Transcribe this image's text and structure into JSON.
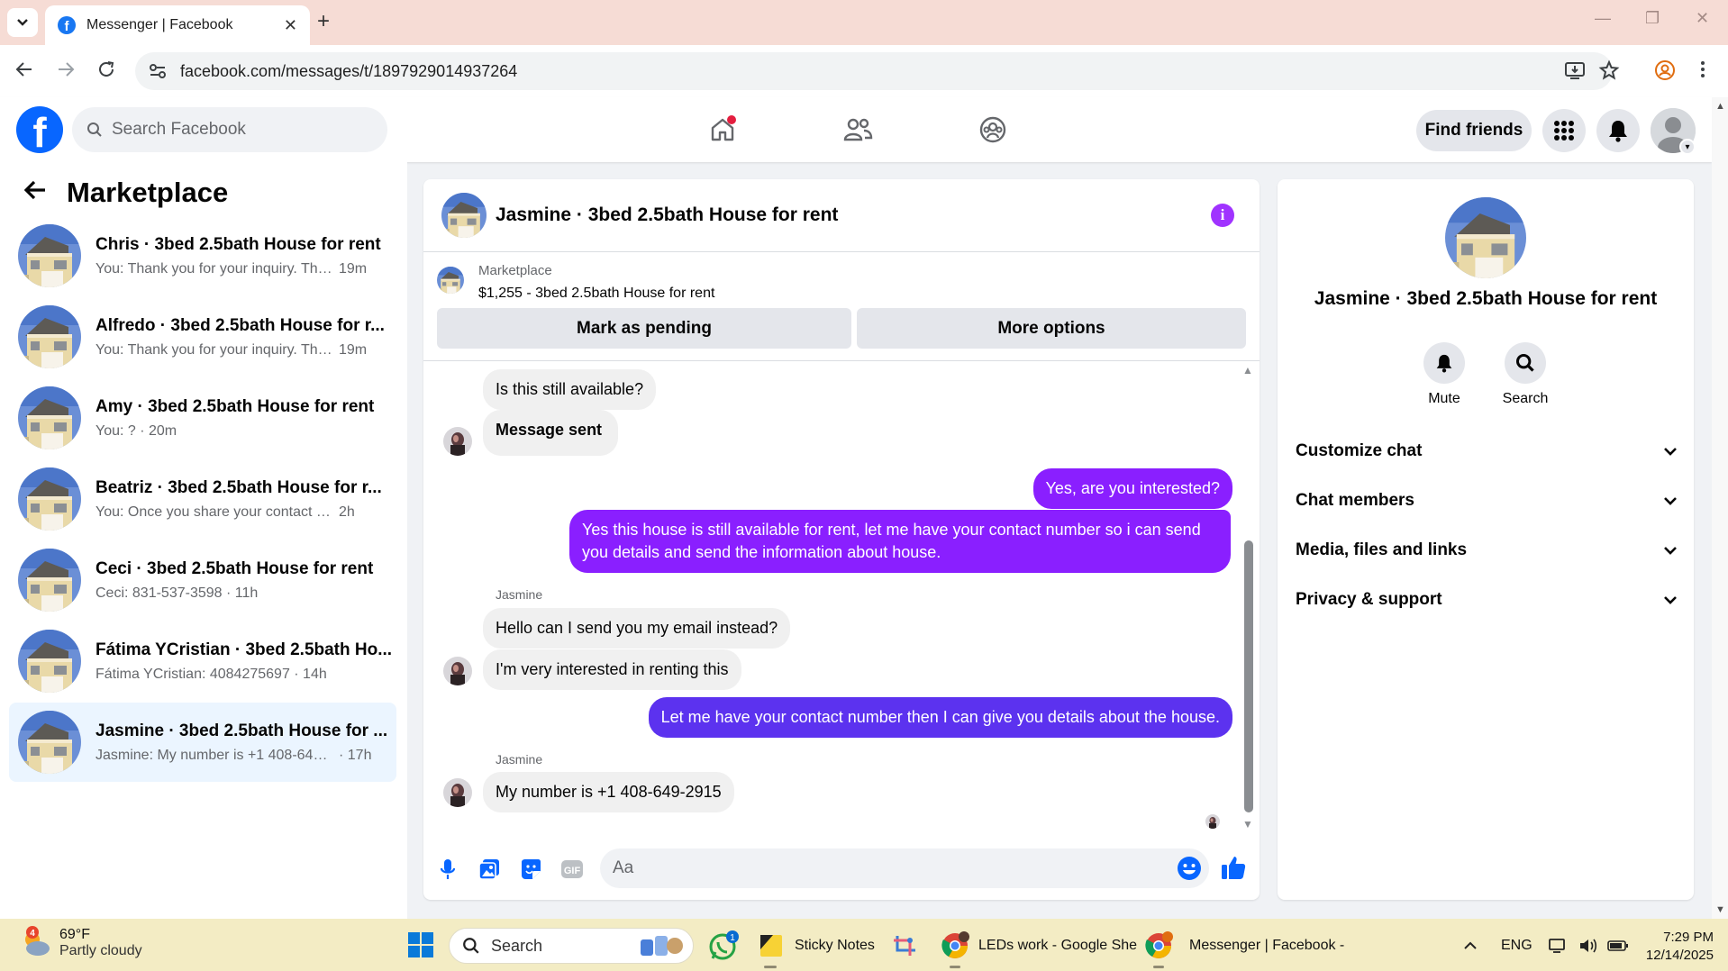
{
  "browser": {
    "tab_title": "Messenger | Facebook",
    "url": "facebook.com/messages/t/1897929014937264"
  },
  "fb": {
    "search_placeholder": "Search Facebook",
    "find_friends": "Find friends"
  },
  "sidebar": {
    "title": "Marketplace",
    "conversations": [
      {
        "name": "Chris · 3bed 2.5bath House for rent",
        "preview": "You: Thank you for your inquiry. The...",
        "time": "19m"
      },
      {
        "name": "Alfredo · 3bed 2.5bath House for r...",
        "preview": "You: Thank you for your inquiry. The...",
        "time": "19m"
      },
      {
        "name": "Amy · 3bed 2.5bath House for rent",
        "preview": "You: ? · 20m",
        "time": ""
      },
      {
        "name": "Beatriz · 3bed 2.5bath House for r...",
        "preview": "You: Once you share your contact nu...",
        "time": "2h"
      },
      {
        "name": "Ceci · 3bed 2.5bath House for rent",
        "preview": "Ceci: 831-537-3598 · 11h",
        "time": ""
      },
      {
        "name": "Fátima YCristian · 3bed 2.5bath Ho...",
        "preview": "Fátima YCristian: 4084275697 · 14h",
        "time": ""
      },
      {
        "name": "Jasmine · 3bed 2.5bath House for ...",
        "preview": "Jasmine: My number is +1 408-649-...",
        "time": "· 17h"
      }
    ]
  },
  "chat": {
    "title": "Jasmine · 3bed 2.5bath House for rent",
    "listing_source": "Marketplace",
    "listing_title": "$1,255 - 3bed 2.5bath House for rent",
    "btn_pending": "Mark as pending",
    "btn_more": "More options",
    "messages": [
      {
        "text": "Is this still available?"
      },
      {
        "text": "Message sent"
      },
      {
        "text": "Yes, are you interested?"
      },
      {
        "text": "Yes this house is still available for rent, let me have your contact number so i can send you details and send the information about house."
      },
      {
        "sender": "Jasmine"
      },
      {
        "text": "Hello can I send you my email instead?"
      },
      {
        "text": "I'm very interested in renting this"
      },
      {
        "text": "Let me have your contact number then I can give you details about the house."
      },
      {
        "sender": "Jasmine"
      },
      {
        "text": "My number is +1 408-649-2915"
      }
    ],
    "composer_placeholder": "Aa"
  },
  "info_panel": {
    "title": "Jasmine · 3bed 2.5bath House for rent",
    "mute": "Mute",
    "search": "Search",
    "sections": [
      "Customize chat",
      "Chat members",
      "Media, files and links",
      "Privacy & support"
    ]
  },
  "taskbar": {
    "weather_badge": "4",
    "temp": "69°F",
    "condition": "Partly cloudy",
    "search": "Search",
    "whatsapp_badge": "1",
    "sticky_notes": "Sticky Notes",
    "chrome1": "LEDs work - Google She",
    "chrome2": "Messenger | Facebook -",
    "lang": "ENG",
    "time": "7:29 PM",
    "date": "12/14/2025"
  },
  "colors": {
    "fb_blue": "#0866ff",
    "outgoing_purple": "#8a1fff",
    "outgoing_blue": "#5c32ef",
    "incoming_gray": "#f0f0f0",
    "active_conv": "#ebf5ff"
  }
}
